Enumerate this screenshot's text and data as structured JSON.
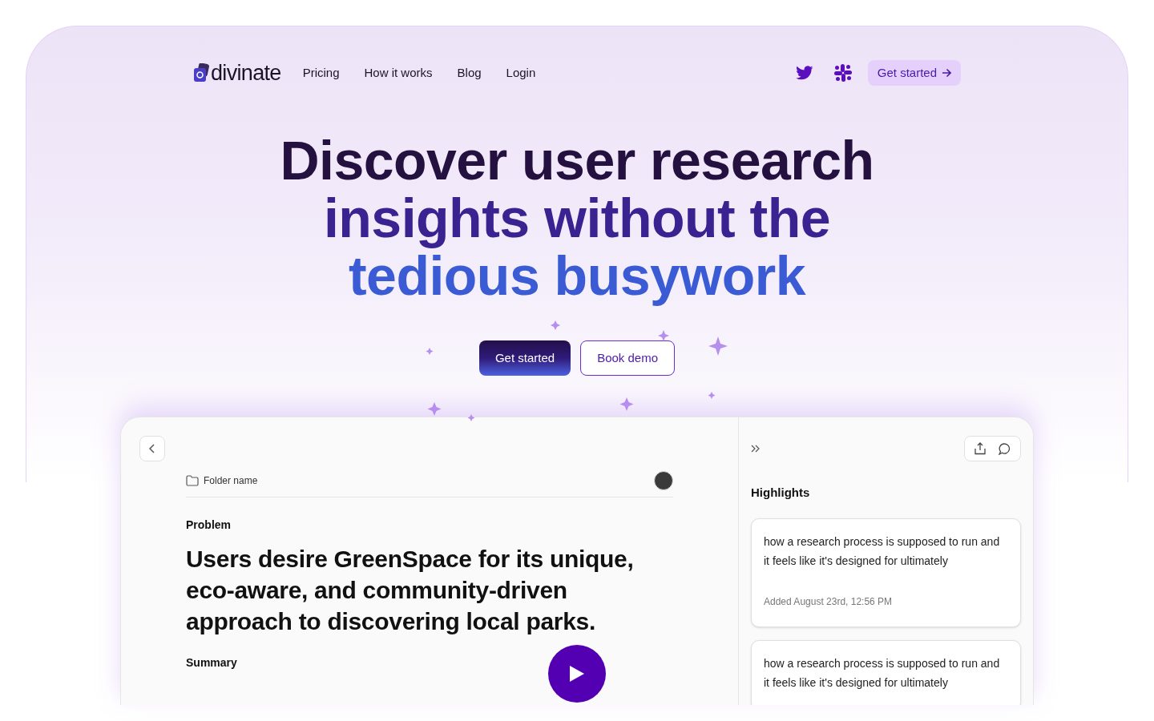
{
  "nav": {
    "logo": "divinate",
    "links": [
      "Pricing",
      "How it works",
      "Blog",
      "Login"
    ],
    "cta": "Get started"
  },
  "hero": {
    "lines": [
      {
        "text": "Discover user research",
        "color": "#25113f"
      },
      {
        "text": "insights without the",
        "color": "#3a2290"
      },
      {
        "text": "tedious busywork",
        "color": "#3b5bd4"
      }
    ],
    "primary_button": "Get started",
    "secondary_button": "Book demo"
  },
  "document": {
    "folder": "Folder name",
    "section_label": "Problem",
    "heading": "Users desire GreenSpace for its unique, eco-aware, and community-driven approach to discovering local parks.",
    "summary_label": "Summary"
  },
  "highlights": {
    "title": "Highlights",
    "cards": [
      {
        "text": "how a research process is supposed to run and it feels like it's designed for ultimately",
        "meta": "Added August 23rd, 12:56 PM"
      },
      {
        "text": "how a research process is supposed to run and it feels like it's designed for ultimately"
      }
    ]
  }
}
